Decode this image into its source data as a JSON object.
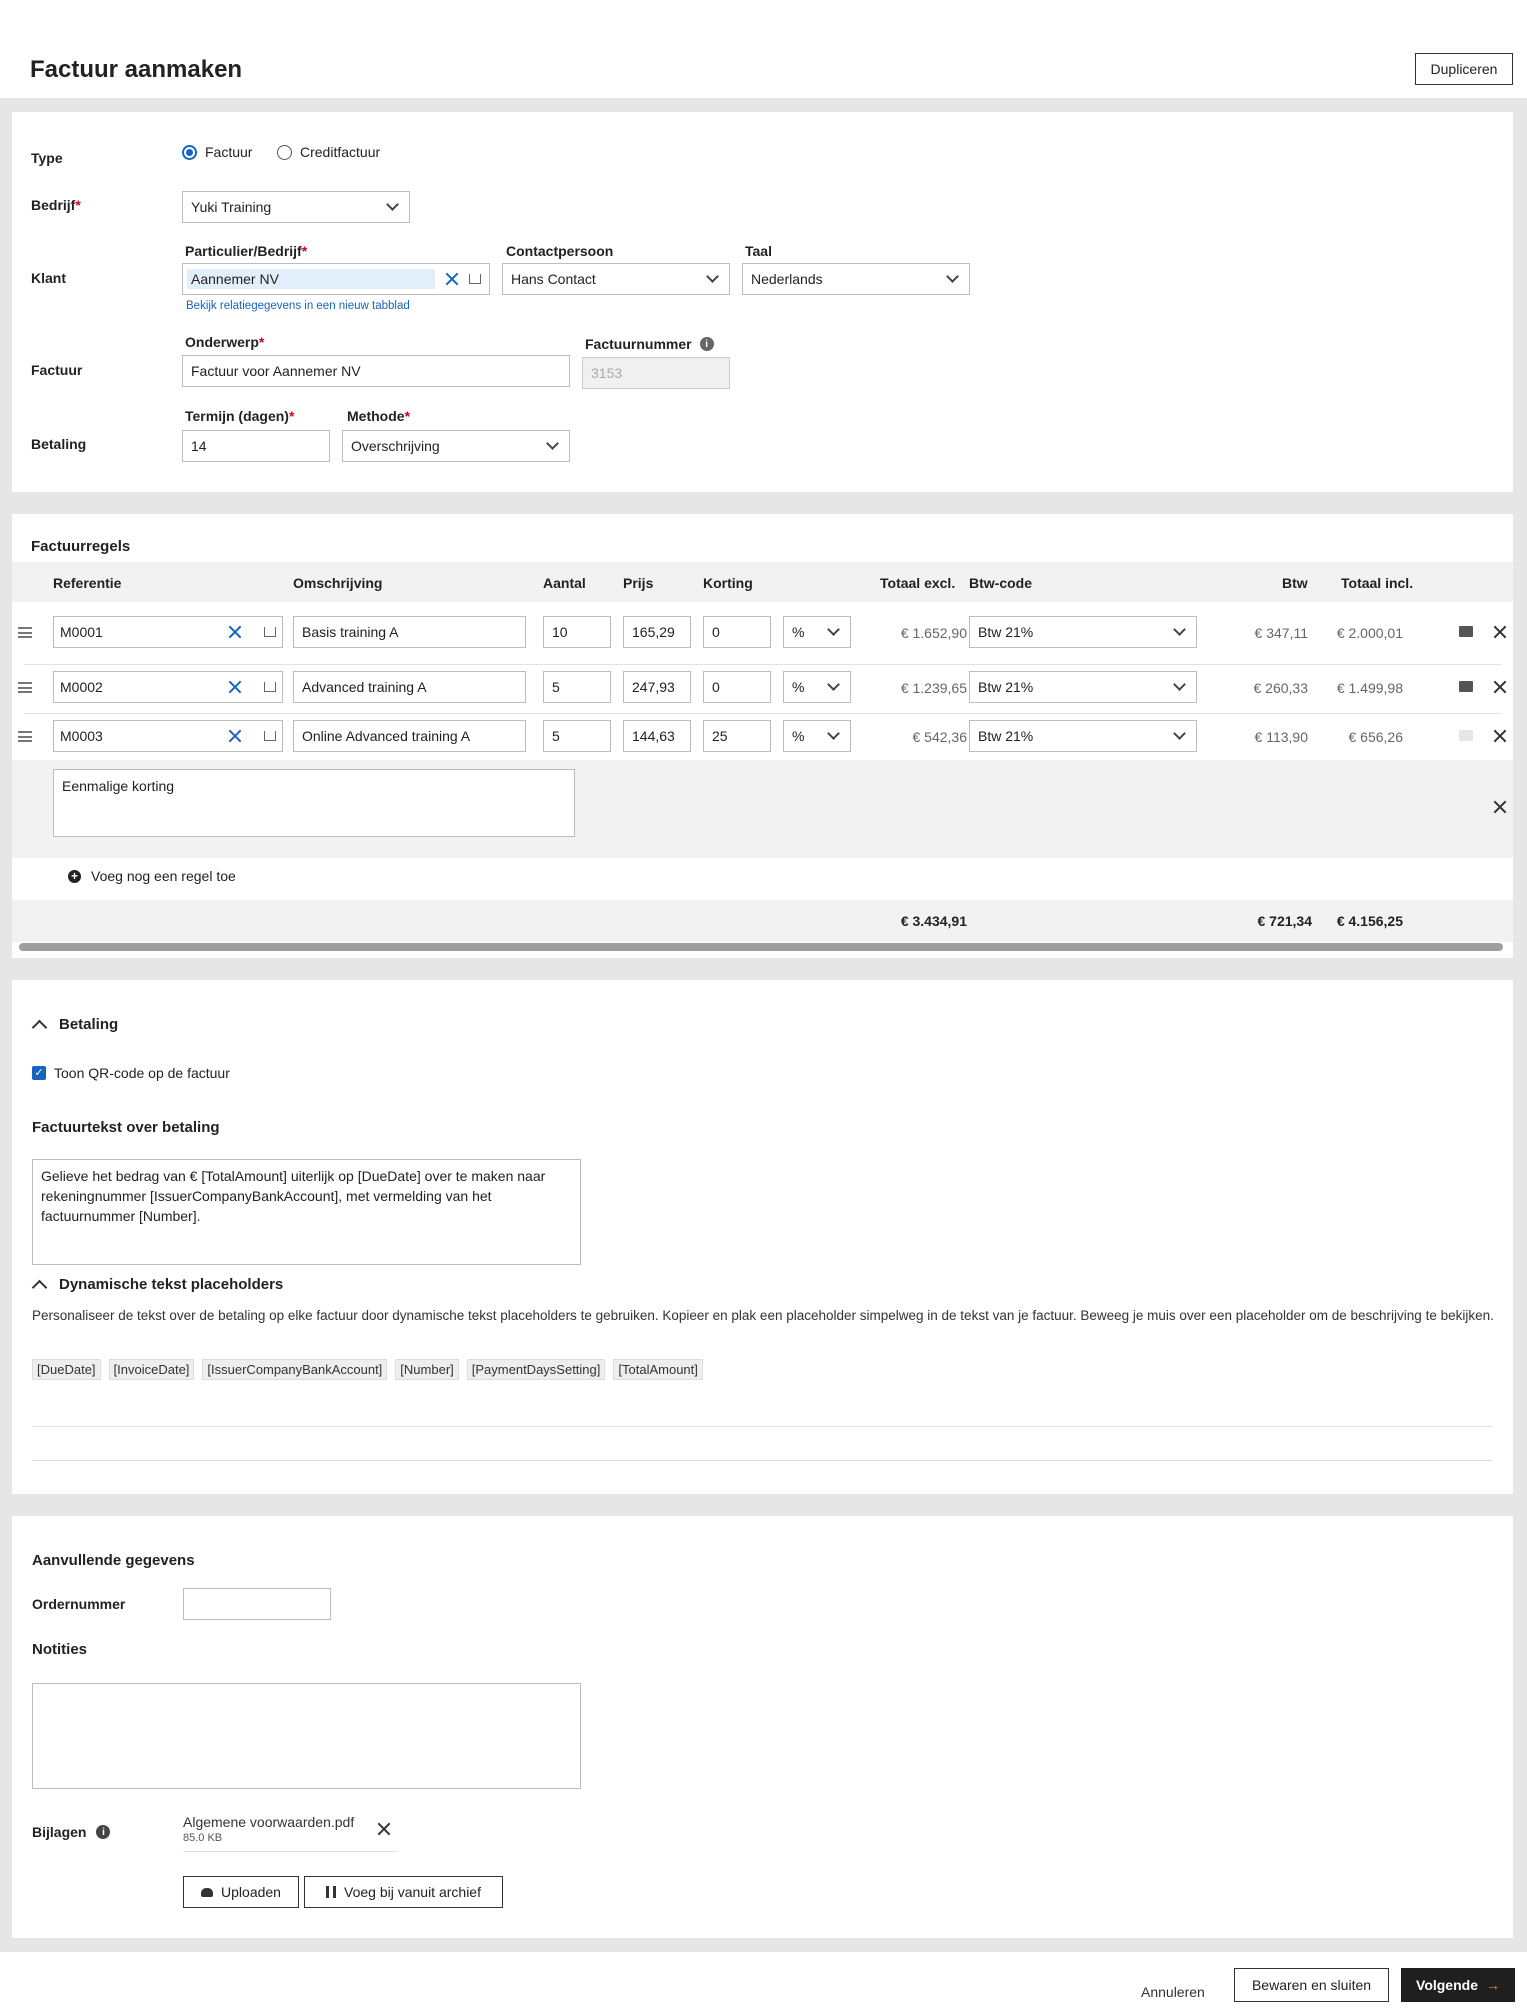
{
  "header": {
    "title": "Factuur aanmaken",
    "duplicate_label": "Dupliceren"
  },
  "general": {
    "type_label": "Type",
    "type_options": [
      "Factuur",
      "Creditfactuur"
    ],
    "type_selected": "Factuur",
    "company_label": "Bedrijf",
    "company_value": "Yuki Training",
    "client_label": "Klant",
    "party_label": "Particulier/Bedrijf",
    "party_value": "Aannemer NV",
    "contact_label": "Contactpersoon",
    "contact_value": "Hans Contact",
    "language_label": "Taal",
    "language_value": "Nederlands",
    "relation_link": "Bekijk relatiegegevens in een nieuw tabblad",
    "invoice_label": "Factuur",
    "subject_label": "Onderwerp",
    "subject_value": "Factuur voor Aannemer NV",
    "number_label": "Factuurnummer",
    "number_placeholder": "3153",
    "payment_label": "Betaling",
    "term_label": "Termijn (dagen)",
    "term_value": "14",
    "method_label": "Methode",
    "method_value": "Overschrijving"
  },
  "lines": {
    "title": "Factuurregels",
    "columns": {
      "ref": "Referentie",
      "desc": "Omschrijving",
      "qty": "Aantal",
      "price": "Prijs",
      "discount": "Korting",
      "total_excl": "Totaal excl.",
      "vat_code": "Btw-code",
      "vat": "Btw",
      "total_incl": "Totaal incl."
    },
    "rows": [
      {
        "ref": "M0001",
        "desc": "Basis training A",
        "qty": "10",
        "price": "165,29",
        "discount": "0",
        "unit": "%",
        "total_excl": "€ 1.652,90",
        "vat_code": "Btw 21%",
        "vat": "€ 347,11",
        "total_incl": "€ 2.000,01"
      },
      {
        "ref": "M0002",
        "desc": "Advanced training A",
        "qty": "5",
        "price": "247,93",
        "discount": "0",
        "unit": "%",
        "total_excl": "€ 1.239,65",
        "vat_code": "Btw 21%",
        "vat": "€ 260,33",
        "total_incl": "€ 1.499,98"
      },
      {
        "ref": "M0003",
        "desc": "Online Advanced training A",
        "qty": "5",
        "price": "144,63",
        "discount": "25",
        "unit": "%",
        "total_excl": "€ 542,36",
        "vat_code": "Btw 21%",
        "vat": "€ 113,90",
        "total_incl": "€ 656,26"
      }
    ],
    "text_line": "Eenmalige korting",
    "add_line": "Voeg nog een regel toe",
    "totals": {
      "excl": "€ 3.434,91",
      "vat": "€ 721,34",
      "incl": "€ 4.156,25"
    }
  },
  "payment": {
    "title": "Betaling",
    "qr_label": "Toon QR-code op de factuur",
    "qr_checked": true,
    "text_title": "Factuurtekst over betaling",
    "text_value": "Gelieve het bedrag van € [TotalAmount] uiterlijk op [DueDate] over te maken naar rekeningnummer [IssuerCompanyBankAccount], met vermelding van het factuurnummer [Number].",
    "placeholders_title": "Dynamische tekst placeholders",
    "placeholders_desc": "Personaliseer de tekst over de betaling op elke factuur door dynamische tekst placeholders te gebruiken. Kopieer en plak een placeholder simpelweg in de tekst van je factuur. Beweeg je muis over een placeholder om de beschrijving te bekijken.",
    "tags": [
      "[DueDate]",
      "[InvoiceDate]",
      "[IssuerCompanyBankAccount]",
      "[Number]",
      "[PaymentDaysSetting]",
      "[TotalAmount]"
    ]
  },
  "additional": {
    "title": "Aanvullende gegevens",
    "order_label": "Ordernummer",
    "order_value": "",
    "notes_title": "Notities",
    "notes_value": "",
    "attachments_label": "Bijlagen",
    "file_name": "Algemene voorwaarden.pdf",
    "file_size": "85.0 KB",
    "upload_label": "Uploaden",
    "archive_label": "Voeg bij vanuit archief"
  },
  "footer": {
    "cancel": "Annuleren",
    "save_close": "Bewaren en sluiten",
    "next": "Volgende"
  },
  "colors": {
    "accent": "#1565c0",
    "required": "#d0021b",
    "dark_button": "#1f1f1f",
    "arrow": "#f08a24"
  }
}
